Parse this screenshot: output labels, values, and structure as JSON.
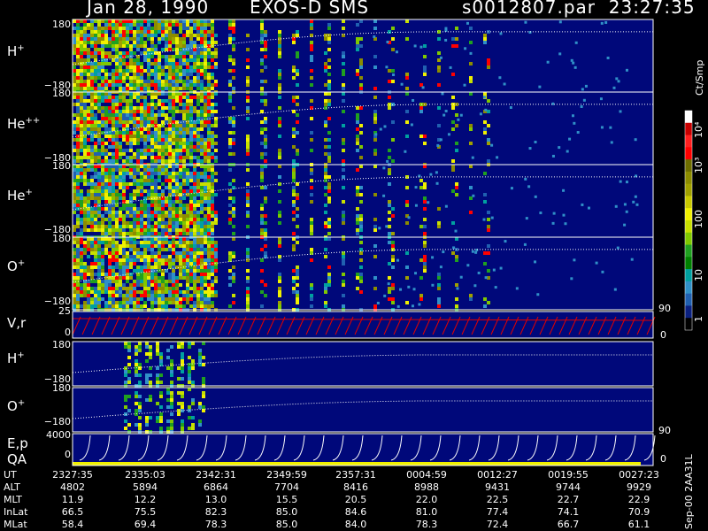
{
  "header": {
    "date": "Jan 28, 1990",
    "mission": "EXOS-D SMS",
    "file_time": "s0012807.par  23:27:35"
  },
  "panels": [
    {
      "label": "H",
      "sup": "+",
      "top_tick": "180",
      "bottom_tick": "−180"
    },
    {
      "label": "He",
      "sup": "++",
      "top_tick": "180",
      "bottom_tick": "−180"
    },
    {
      "label": "He",
      "sup": "+",
      "top_tick": "180",
      "bottom_tick": "−180"
    },
    {
      "label": "O",
      "sup": "+",
      "top_tick": "180",
      "bottom_tick": "−180"
    },
    {
      "label": "V,r",
      "sup": "",
      "top_tick": "25",
      "bottom_tick": "0",
      "right_top": "90",
      "right_bottom": "0"
    },
    {
      "label": "H",
      "sup": "+",
      "top_tick": "180",
      "bottom_tick": "−180"
    },
    {
      "label": "O",
      "sup": "+",
      "top_tick": "180",
      "bottom_tick": "−180"
    },
    {
      "label": "E,p",
      "label2": "QA",
      "top_tick": "4000",
      "bottom_tick": "0",
      "right_top": "90",
      "right_bottom": "0"
    }
  ],
  "colorbar": {
    "unit": "Ct/Smp",
    "labels": [
      "10⁴",
      "10³",
      "100",
      "10",
      "1"
    ],
    "colors": [
      "#ffffff",
      "#c80000",
      "#ff2020",
      "#ff0000",
      "#6e6e00",
      "#8c8c00",
      "#a0a000",
      "#c8c800",
      "#f0f000",
      "#c8e000",
      "#80c800",
      "#20a020",
      "#008000",
      "#00a0a0",
      "#3090c8",
      "#2060b0",
      "#0a2080",
      "#000000"
    ]
  },
  "footer_vertical": "Sep-00  2AA31L",
  "table": {
    "headers": [
      "UT",
      "ALT",
      "MLT",
      "InLat",
      "MLat"
    ],
    "columns": [
      [
        "2327:35",
        "4802",
        "11.9",
        "66.5",
        "58.4"
      ],
      [
        "2335:03",
        "5894",
        "12.2",
        "75.5",
        "69.4"
      ],
      [
        "2342:31",
        "6864",
        "13.0",
        "82.3",
        "78.3"
      ],
      [
        "2349:59",
        "7704",
        "15.5",
        "85.0",
        "85.0"
      ],
      [
        "2357:31",
        "8416",
        "20.5",
        "84.6",
        "84.0"
      ],
      [
        "0004:59",
        "8988",
        "22.0",
        "81.0",
        "78.3"
      ],
      [
        "0012:27",
        "9431",
        "22.5",
        "77.4",
        "72.4"
      ],
      [
        "0019:55",
        "9744",
        "22.7",
        "74.1",
        "66.7"
      ],
      [
        "0027:23",
        "9929",
        "22.9",
        "70.9",
        "61.1"
      ]
    ]
  },
  "chart_data": {
    "type": "heatmap",
    "title": "Jan 28, 1990   EXOS-D SMS",
    "x_ticks": [
      "2327:35",
      "2335:03",
      "2342:31",
      "2349:59",
      "2357:31",
      "0004:59",
      "0012:27",
      "0019:55",
      "0027:23"
    ],
    "colorscale_unit": "Ct/Smp",
    "colorscale_range": [
      1,
      10000
    ],
    "colorscale": "log",
    "panels": [
      "H+",
      "He++",
      "He+",
      "O+",
      "V,r",
      "H+",
      "O+",
      "E,p QA"
    ],
    "pitch_angle_range": [
      -180,
      180
    ]
  },
  "colors": {
    "background_plot": "#00087a",
    "navy": "#0a1e80",
    "line": "#ffffff",
    "red_line": "#e00000",
    "qa_bar": "#f0f000"
  }
}
